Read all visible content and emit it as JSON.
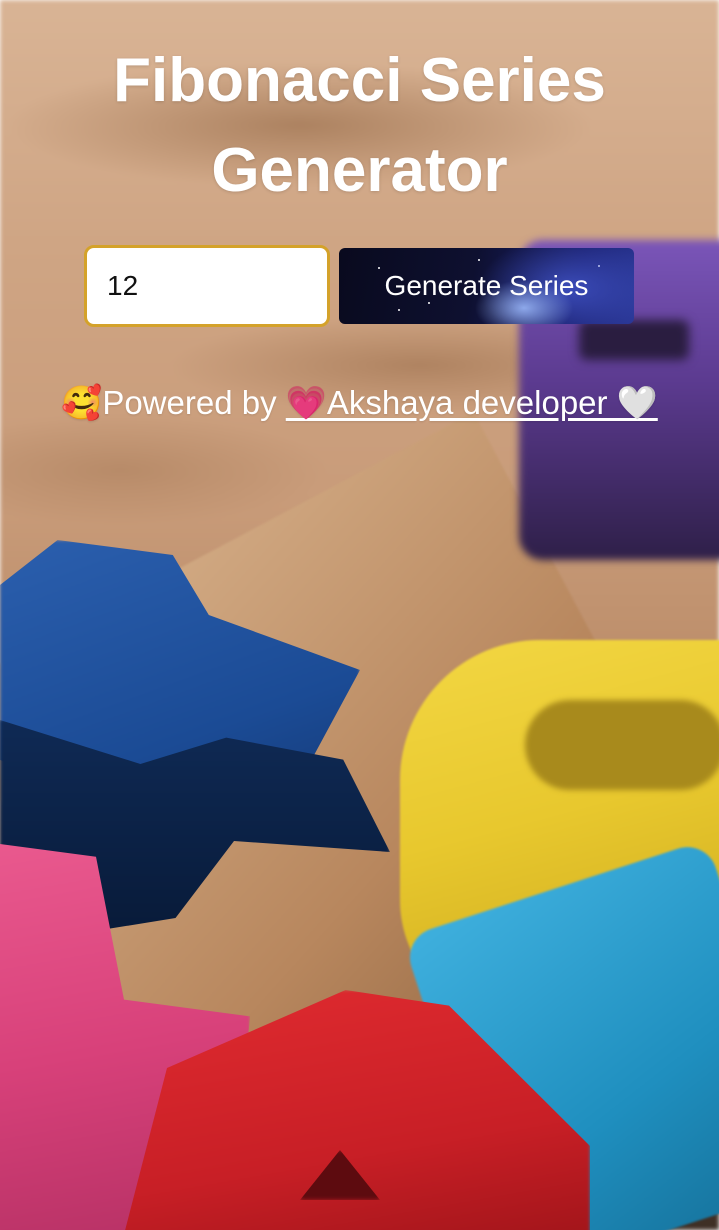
{
  "page": {
    "title": "Fibonacci Series Generator"
  },
  "form": {
    "input_value": "12",
    "button_label": "Generate Series"
  },
  "footer": {
    "emoji": "🥰",
    "powered_by_text": "Powered by ",
    "link_text": "💗Akshaya developer 🤍"
  },
  "colors": {
    "input_border": "#d4a22a",
    "title_text": "#ffffff",
    "button_bg": "#0e1030"
  }
}
